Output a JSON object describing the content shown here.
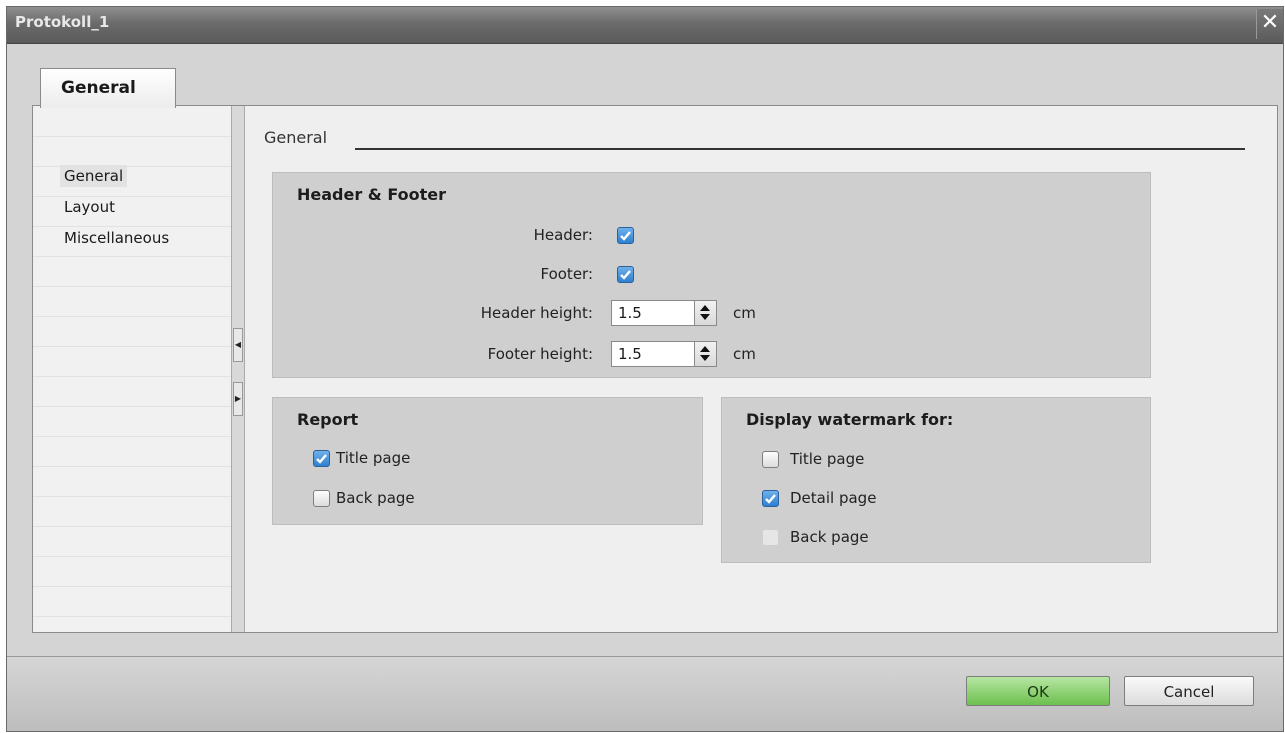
{
  "window": {
    "title": "Protokoll_1",
    "close_symbol": "✕"
  },
  "tab": {
    "label": "General"
  },
  "nav": {
    "items": [
      {
        "label": "General",
        "selected": true
      },
      {
        "label": "Layout",
        "selected": false
      },
      {
        "label": "Miscellaneous",
        "selected": false
      }
    ]
  },
  "section": {
    "title": "General"
  },
  "header_footer": {
    "title": "Header & Footer",
    "header_label": "Header:",
    "header_checked": true,
    "footer_label": "Footer:",
    "footer_checked": true,
    "header_height_label": "Header height:",
    "header_height_value": "1.5",
    "footer_height_label": "Footer height:",
    "footer_height_value": "1.5",
    "unit": "cm"
  },
  "report": {
    "title": "Report",
    "items": [
      {
        "label": "Title page",
        "checked": true
      },
      {
        "label": "Back page",
        "checked": false
      }
    ]
  },
  "watermark": {
    "title": "Display watermark for:",
    "items": [
      {
        "label": "Title page",
        "checked": false
      },
      {
        "label": "Detail page",
        "checked": true
      },
      {
        "label": "Back page",
        "checked": false,
        "disabled": true
      }
    ]
  },
  "buttons": {
    "ok": "OK",
    "cancel": "Cancel"
  },
  "colors": {
    "ok_green": "#6cc04e",
    "check_blue": "#2f7fcf",
    "titlebar": "#6b6b6b"
  }
}
